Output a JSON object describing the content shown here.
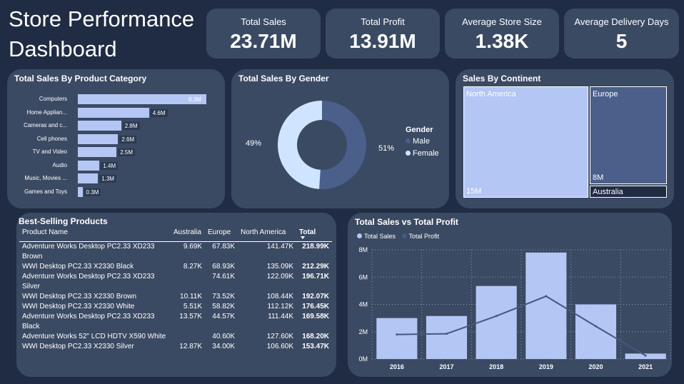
{
  "title": "Store Performance Dashboard",
  "kpis": {
    "total_sales": {
      "label": "Total Sales",
      "value": "23.71M"
    },
    "total_profit": {
      "label": "Total Profit",
      "value": "13.91M"
    },
    "avg_store_size": {
      "label": "Average Store Size",
      "value": "1.38K"
    },
    "avg_delivery": {
      "label": "Average Delivery Days",
      "value": "5"
    }
  },
  "category_card": {
    "title": "Total Sales By Product Category"
  },
  "gender_card": {
    "title": "Total Sales By Gender",
    "legend_title": "Gender",
    "male_label": "Male",
    "female_label": "Female",
    "male_pct": "51%",
    "female_pct": "49%"
  },
  "continent_card": {
    "title": "Sales By Continent",
    "na_label": "North America",
    "na_value": "15M",
    "eu_label": "Europe",
    "eu_value": "8M",
    "au_label": "Australia"
  },
  "products_card": {
    "title": "Best-Selling Products",
    "headers": [
      "Product Name",
      "Australia",
      "Europe",
      "North America",
      "Total"
    ],
    "rows": [
      [
        "Adventure Works Desktop PC2.33 XD233 Brown",
        "9.69K",
        "67.83K",
        "141.47K",
        "218.99K"
      ],
      [
        "WWI Desktop PC2.33 X2330 Black",
        "8.27K",
        "68.93K",
        "135.09K",
        "212.29K"
      ],
      [
        "Adventure Works Desktop PC2.33 XD233 Silver",
        "",
        "74.61K",
        "122.09K",
        "196.71K"
      ],
      [
        "WWI Desktop PC2.33 X2330 Brown",
        "10.11K",
        "73.52K",
        "108.44K",
        "192.07K"
      ],
      [
        "WWI Desktop PC2.33 X2330 White",
        "5.51K",
        "58.82K",
        "112.12K",
        "176.45K"
      ],
      [
        "Adventure Works Desktop PC2.33 XD233 Black",
        "13.57K",
        "44.57K",
        "111.44K",
        "169.58K"
      ],
      [
        "Adventure Works 52\" LCD HDTV X590 White",
        "",
        "40.60K",
        "127.60K",
        "168.20K"
      ],
      [
        "WWI Desktop PC2.33 X2330 Silver",
        "12.87K",
        "34.00K",
        "106.60K",
        "153.47K"
      ]
    ]
  },
  "sales_profit_card": {
    "title": "Total Sales vs Total Profit"
  },
  "colors": {
    "bar": "#b4c6f4",
    "male": "#4a5f8a",
    "female": "#cfe5ff",
    "profit_line": "#43597f"
  },
  "chart_data": [
    {
      "type": "bar",
      "title": "Total Sales By Product Category",
      "categories": [
        "Computers",
        "Home Applian...",
        "Cameras and c...",
        "Cell phones",
        "TV and Video",
        "Audio",
        "Music, Movies ...",
        "Games and Toys"
      ],
      "values": [
        8.3,
        4.6,
        2.8,
        2.6,
        2.5,
        1.4,
        1.3,
        0.3
      ],
      "value_labels": [
        "8.3M",
        "4.6M",
        "2.8M",
        "2.6M",
        "2.5M",
        "1.4M",
        "1.3M",
        "0.3M"
      ],
      "orientation": "horizontal",
      "unit": "M"
    },
    {
      "type": "pie",
      "title": "Total Sales By Gender",
      "labels": [
        "Male",
        "Female"
      ],
      "values": [
        51,
        49
      ],
      "donut": true
    },
    {
      "type": "heatmap",
      "title": "Sales By Continent",
      "labels": [
        "North America",
        "Europe",
        "Australia"
      ],
      "values": [
        15,
        8,
        1
      ],
      "unit": "M",
      "style": "treemap"
    },
    {
      "type": "bar",
      "title": "Total Sales vs Total Profit",
      "categories": [
        "2016",
        "2017",
        "2018",
        "2019",
        "2020",
        "2021"
      ],
      "series": [
        {
          "name": "Total Sales",
          "type": "bar",
          "values": [
            3.0,
            3.15,
            5.35,
            7.8,
            4.0,
            0.4
          ]
        },
        {
          "name": "Total Profit",
          "type": "line",
          "values": [
            1.8,
            1.85,
            3.15,
            4.6,
            2.4,
            0.25
          ]
        }
      ],
      "yticks": [
        "0M",
        "2M",
        "4M",
        "6M",
        "8M"
      ],
      "ylim": [
        0,
        8
      ],
      "grid": true,
      "legend": "top-left"
    }
  ]
}
